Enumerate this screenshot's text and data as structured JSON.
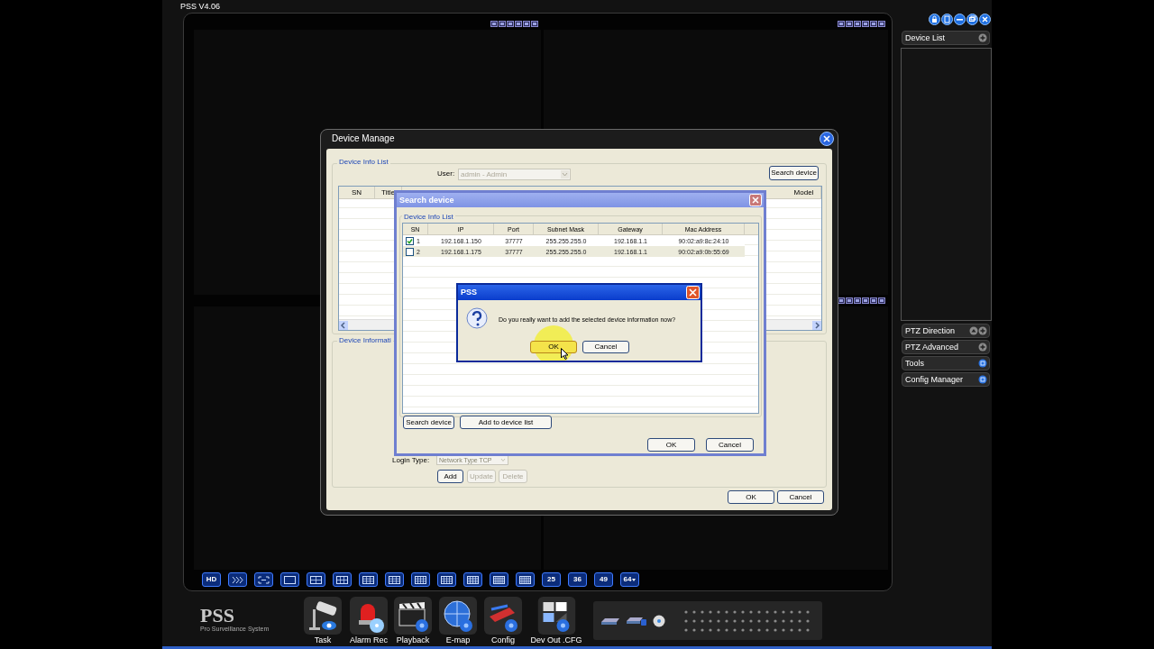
{
  "app": {
    "title": "PSS V4.06"
  },
  "side_panel": {
    "device_list": {
      "title": "Device List"
    },
    "sections": [
      {
        "label": "PTZ Direction",
        "kind": "ptz"
      },
      {
        "label": "PTZ Advanced",
        "kind": "plus"
      },
      {
        "label": "Tools",
        "kind": "panel"
      },
      {
        "label": "Config Manager",
        "kind": "panel"
      }
    ]
  },
  "layout_labels": [
    {
      "label": "HD",
      "dropdown": false
    },
    {
      "label": "25",
      "dropdown": false
    },
    {
      "label": "36",
      "dropdown": false
    },
    {
      "label": "49",
      "dropdown": false
    },
    {
      "label": "64",
      "dropdown": true
    }
  ],
  "dock": {
    "logo": "PSS",
    "logo_subtitle": "Pro Surveillance System",
    "apps": [
      "Task",
      "Alarm Rec",
      "Playback",
      "E-map",
      "Config",
      "Dev Out .CFG"
    ]
  },
  "device_manage": {
    "title": "Device Manage",
    "list_group": "Device Info List",
    "user_label": "User:",
    "user_value": "admin - Admin",
    "search_button": "Search device",
    "columns": [
      "SN",
      "Title",
      "Model"
    ],
    "info_group": "Device Informati",
    "login_type_label": "Login Type:",
    "login_type_value": "Network Type TCP",
    "actions": [
      {
        "label": "Add",
        "disabled": false
      },
      {
        "label": "Update",
        "disabled": true
      },
      {
        "label": "Delete",
        "disabled": true
      }
    ],
    "buttons": [
      "OK",
      "Cancel"
    ]
  },
  "search_device": {
    "title": "Search device",
    "group": "Device Info List",
    "columns": [
      "SN",
      "IP",
      "Port",
      "Subnet Mask",
      "Gateway",
      "Mac Address"
    ],
    "rows": [
      {
        "checked": true,
        "selected": false,
        "cells": [
          "1",
          "192.168.1.150",
          "37777",
          "255.255.255.0",
          "192.168.1.1",
          "90:02:a9:8c:24:10"
        ]
      },
      {
        "checked": false,
        "selected": true,
        "cells": [
          "2",
          "192.168.1.175",
          "37777",
          "255.255.255.0",
          "192.168.1.1",
          "90:02:a9:0b:55:69"
        ]
      }
    ],
    "left_buttons": [
      "Search device",
      "Add to device list"
    ],
    "buttons": [
      "OK",
      "Cancel"
    ]
  },
  "confirm": {
    "title": "PSS",
    "message": "Do you really want to add the selected device information now?",
    "buttons": [
      {
        "label": "OK",
        "hovered": true
      },
      {
        "label": "Cancel",
        "hovered": false
      }
    ]
  }
}
